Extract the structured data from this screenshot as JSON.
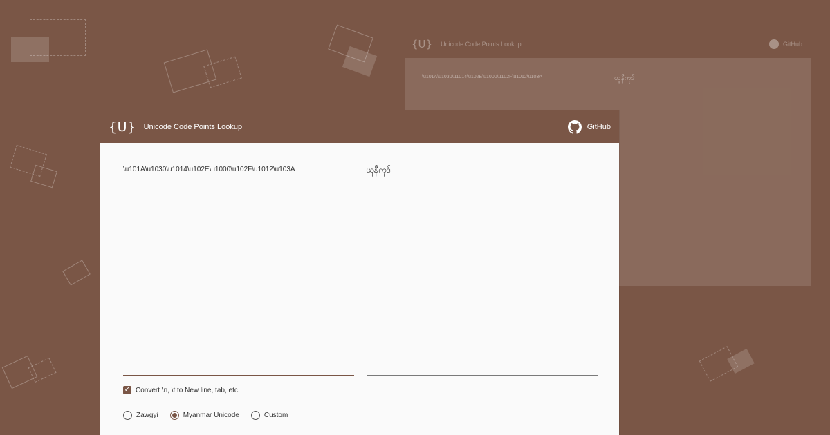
{
  "app": {
    "logo": "{U}",
    "title": "Unicode Code Points Lookup",
    "github_label": "GitHub"
  },
  "input": {
    "value": "\\u101A\\u1030\\u1014\\u102E\\u1000\\u102F\\u1012\\u103A"
  },
  "output": {
    "value": "ယူနီကုဒ်"
  },
  "options": {
    "convert_escapes": {
      "label": "Convert \\n, \\t to New line, tab, etc.",
      "checked": true
    },
    "encoding": {
      "items": [
        {
          "label": "Zawgyi",
          "selected": false
        },
        {
          "label": "Myanmar Unicode",
          "selected": true
        },
        {
          "label": "Custom",
          "selected": false
        }
      ]
    }
  },
  "background_window": {
    "logo": "{U}",
    "title": "Unicode Code Points Lookup",
    "github_label": "GitHub",
    "input_value": "\\u101A\\u1030\\u1014\\u102E\\u1000\\u102F\\u1012\\u103A",
    "output_value": "ယူနီကုဒ်"
  },
  "colors": {
    "brand": "#7a5646",
    "surface": "#fafafa"
  }
}
